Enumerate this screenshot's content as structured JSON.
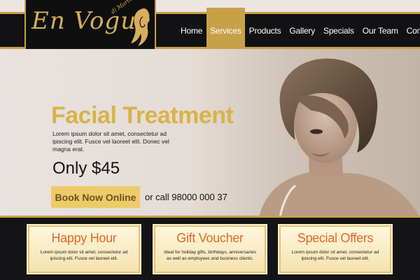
{
  "brand": {
    "logo_text": "En Vogue",
    "logo_sub": "di Marinelli"
  },
  "nav": {
    "items": [
      {
        "label": "Home",
        "active": false
      },
      {
        "label": "Services",
        "active": true
      },
      {
        "label": "Products",
        "active": false
      },
      {
        "label": "Gallery",
        "active": false
      },
      {
        "label": "Specials",
        "active": false
      },
      {
        "label": "Our Team",
        "active": false
      },
      {
        "label": "Contact",
        "active": false
      }
    ]
  },
  "hero": {
    "title": "Facial Treatment",
    "body": "Lorem ipsum dolor sit amet, consectetur ad ipiscing elit. Fusce vel laoreet elit. Donec vel magna erat.",
    "price": "Only $45",
    "cta_label": "Book Now Online",
    "call_text": "or call 98000 000 37"
  },
  "cards": [
    {
      "title": "Happy Hour",
      "body": "Lorem ipsum dolor sit amet, consectetur ad ipiscing elit. Fusce vel laoreet elit."
    },
    {
      "title": "Gift Voucher",
      "body": "Ideal for holiday gifts, birthdays, anniversaries as well as employees and business clients."
    },
    {
      "title": "Special Offers",
      "body": "Lorem ipsum dolor sit amet, consectetur ad ipiscing elit. Fusce vel laoreet elit."
    }
  ],
  "colors": {
    "gold": "#c9a04a",
    "title_gold": "#d8b348",
    "button": "#eecb68",
    "card_title": "#e0692c",
    "dark": "#121214"
  }
}
